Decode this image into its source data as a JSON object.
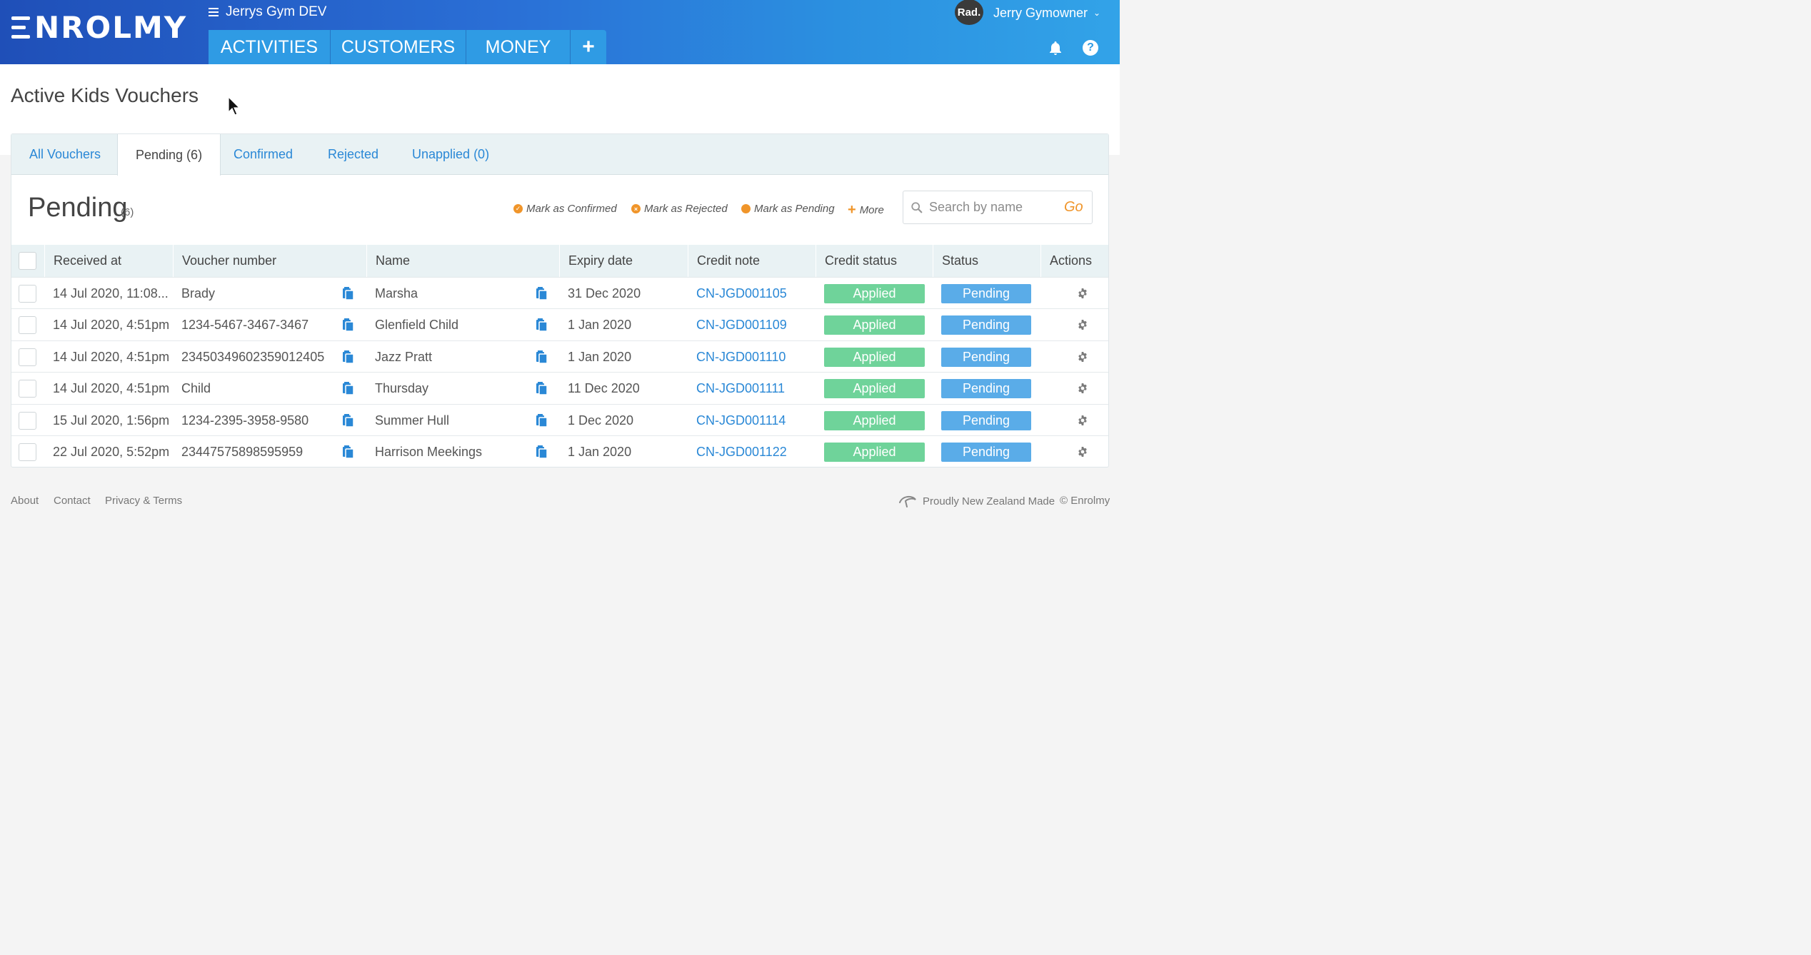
{
  "header": {
    "logo_text": "NROLMY",
    "org_name": "Jerrys Gym DEV",
    "nav": [
      {
        "label": "ACTIVITIES"
      },
      {
        "label": "CUSTOMERS"
      },
      {
        "label": "MONEY"
      },
      {
        "label": "+"
      }
    ],
    "user_avatar": "Rad.",
    "user_name": "Jerry Gymowner",
    "help_label": "?"
  },
  "page": {
    "title": "Active Kids Vouchers"
  },
  "tabs": [
    {
      "label": "All Vouchers"
    },
    {
      "label": "Pending (6)"
    },
    {
      "label": "Confirmed"
    },
    {
      "label": "Rejected"
    },
    {
      "label": "Unapplied (0)"
    }
  ],
  "section": {
    "title": "Pending",
    "count": "(6)"
  },
  "actions": {
    "confirm": "Mark as Confirmed",
    "reject": "Mark as Rejected",
    "pending": "Mark as Pending",
    "more": "More"
  },
  "search": {
    "placeholder": "Search by name",
    "value": "",
    "go": "Go"
  },
  "table": {
    "columns": [
      "Received at",
      "Voucher number",
      "Name",
      "Expiry date",
      "Credit note",
      "Credit status",
      "Status",
      "Actions"
    ],
    "rows": [
      {
        "received": "14 Jul 2020, 11:08...",
        "voucher": "Brady",
        "name": "Marsha",
        "expiry": "31 Dec 2020",
        "credit_note": "CN-JGD001105",
        "credit_status": "Applied",
        "status": "Pending"
      },
      {
        "received": "14 Jul 2020, 4:51pm",
        "voucher": "1234-5467-3467-3467",
        "name": "Glenfield Child",
        "expiry": "1 Jan 2020",
        "credit_note": "CN-JGD001109",
        "credit_status": "Applied",
        "status": "Pending"
      },
      {
        "received": "14 Jul 2020, 4:51pm",
        "voucher": "23450349602359012405",
        "name": "Jazz Pratt",
        "expiry": "1 Jan 2020",
        "credit_note": "CN-JGD001110",
        "credit_status": "Applied",
        "status": "Pending"
      },
      {
        "received": "14 Jul 2020, 4:51pm",
        "voucher": "Child",
        "name": "Thursday",
        "expiry": "11 Dec 2020",
        "credit_note": "CN-JGD001111",
        "credit_status": "Applied",
        "status": "Pending"
      },
      {
        "received": "15 Jul 2020, 1:56pm",
        "voucher": "1234-2395-3958-9580",
        "name": "Summer Hull",
        "expiry": "1 Dec 2020",
        "credit_note": "CN-JGD001114",
        "credit_status": "Applied",
        "status": "Pending"
      },
      {
        "received": "22 Jul 2020, 5:52pm",
        "voucher": "23447575898595959",
        "name": "Harrison Meekings",
        "expiry": "1 Jan 2020",
        "credit_note": "CN-JGD001122",
        "credit_status": "Applied",
        "status": "Pending"
      }
    ]
  },
  "footer": {
    "links": [
      "About",
      "Contact",
      "Privacy & Terms"
    ],
    "nz_made": "Proudly New Zealand Made",
    "copyright": "© Enrolmy"
  },
  "colors": {
    "header_start": "#1f4fb8",
    "header_end": "#32a3e8",
    "nav_tab": "#2f9be4",
    "link": "#2a88d6",
    "accent_orange": "#f0952a",
    "applied_green": "#6fd39a",
    "pending_blue": "#5aace8"
  },
  "icons": [
    "menu-icon",
    "bell-icon",
    "help-icon",
    "search-icon",
    "copy-icon",
    "gear-icon",
    "cursor-icon",
    "nz-icon"
  ]
}
